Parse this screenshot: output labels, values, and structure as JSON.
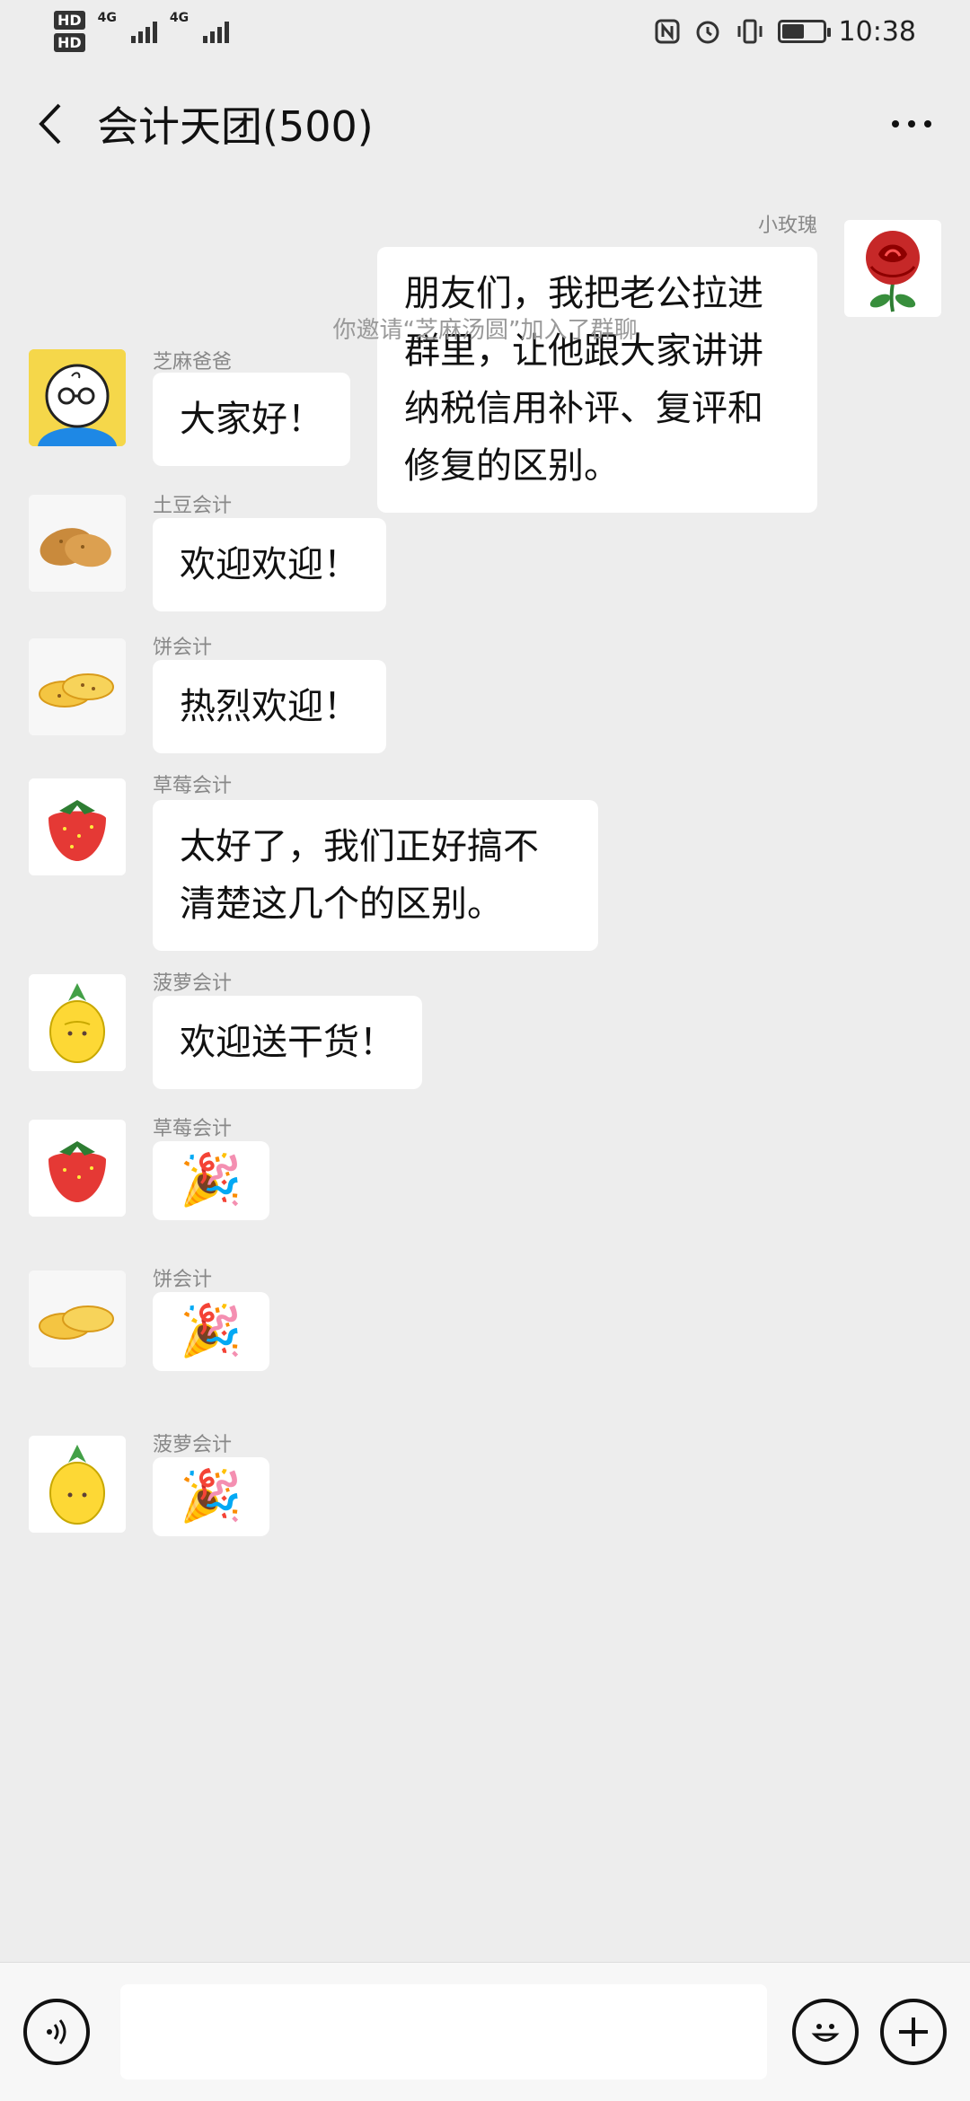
{
  "status_bar": {
    "time": "10:38",
    "sim1": "HD",
    "sim2": "HD",
    "network1": "4G",
    "network2": "4G",
    "battery_level_pct": 55
  },
  "header": {
    "title": "会计天团(500)"
  },
  "messages": [
    {
      "side": "right",
      "sender": "小玫瑰",
      "text": "朋友们，我把老公拉进群里，让他跟大家讲讲纳税信用补评、复评和修复的区别。",
      "avatar_icon": "rose-avatar-icon"
    },
    {
      "type": "system",
      "text": "你邀请“芝麻汤圆”加入了群聊"
    },
    {
      "side": "left",
      "sender": "芝麻爸爸",
      "text": "大家好！",
      "avatar_icon": "cartoon-man-avatar-icon"
    },
    {
      "side": "left",
      "sender": "土豆会计",
      "text": "欢迎欢迎！",
      "avatar_icon": "potato-avatar-icon"
    },
    {
      "side": "left",
      "sender": "饼会计",
      "text": "热烈欢迎！",
      "avatar_icon": "cookies-avatar-icon"
    },
    {
      "side": "left",
      "sender": "草莓会计",
      "text": "太好了，我们正好搞不清楚这几个的区别。",
      "avatar_icon": "strawberry-avatar-icon"
    },
    {
      "side": "left",
      "sender": "菠萝会计",
      "text": "欢迎送干货！",
      "avatar_icon": "pineapple-avatar-icon"
    },
    {
      "side": "left",
      "sender": "草莓会计",
      "text": "🎉",
      "avatar_icon": "strawberry-avatar-icon"
    },
    {
      "side": "left",
      "sender": "饼会计",
      "text": "🎉",
      "avatar_icon": "cookies-avatar-icon"
    },
    {
      "side": "left",
      "sender": "菠萝会计",
      "text": "🎉",
      "avatar_icon": "pineapple-avatar-icon"
    }
  ],
  "input_bar": {
    "value": "",
    "voice_icon": "voice-icon",
    "emoji_icon": "emoji-icon",
    "plus_icon": "plus-icon"
  },
  "colors": {
    "background": "#ededed",
    "bubble": "#ffffff",
    "meta_text": "#888888"
  }
}
